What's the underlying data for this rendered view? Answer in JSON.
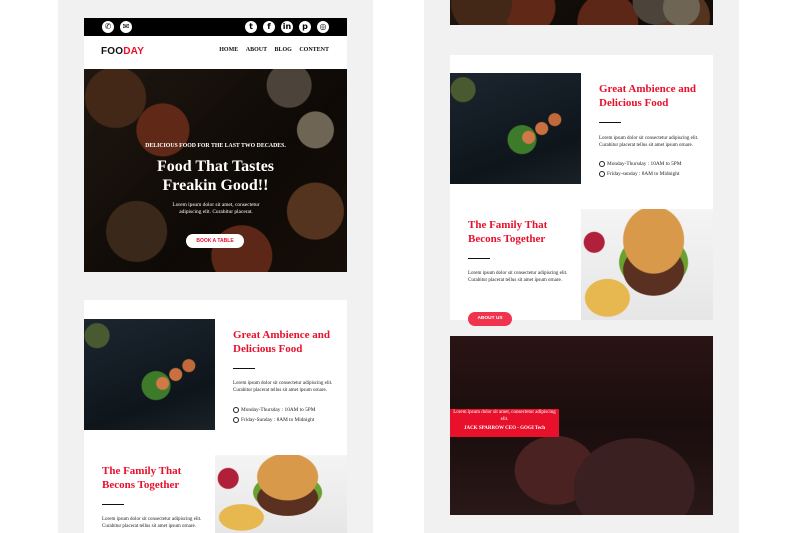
{
  "brand": {
    "logo_part1": "FOO",
    "logo_part2": "DAY"
  },
  "topbar": {
    "contact_icons": [
      "phone-icon",
      "mail-icon"
    ],
    "social_icons": [
      "twitter-icon",
      "facebook-icon",
      "linkedin-icon",
      "pinterest-icon",
      "instagram-icon"
    ]
  },
  "nav": {
    "items": [
      "HOME",
      "ABOUT",
      "BLOG",
      "CONTENT"
    ]
  },
  "hero": {
    "kicker": "DELICIOUS FOOD FOR THE LAST TWO DECADES.",
    "headline_line1": "Food That Tastes",
    "headline_line2": "Freakin Good!!",
    "body": "Lorem ipsum dolor sit amet, consectetur adipiscing elit. Curabitur placerat.",
    "cta": "BOOK A TABLE"
  },
  "ambience": {
    "heading_line1": "Great Ambience and",
    "heading_line2": "Delicious Food",
    "body": "Lorem ipsum dolor sit consectetur adipiscing elit. Curabitur placerat tellus sit amet ipsum ornare.",
    "hours_weekday": "Monday-Thursday : 10AM to 5PM",
    "hours_weekend": "Friday-Sunday : 8AM to Midnight",
    "hours_weekend_right": "Friday-sunday : 8AM to Midnight"
  },
  "family": {
    "heading_line1": "The Family That",
    "heading_line2": "Becons Together",
    "body": "Lorem ipsum dolor sit consectetur adipiscing elit. Curabitur placerat tellus sit amet ipsum ornare.",
    "cta": "ABOUT US"
  },
  "testimonial": {
    "quote": "Lorem ipsum dolor sit amet, consectetur adipiscing elit.",
    "author": "JACK SPARROW CEO - GOGI Tech"
  },
  "colors": {
    "accent": "#e8102b",
    "button": "#f0344e",
    "panel": "#f1f1f1"
  }
}
